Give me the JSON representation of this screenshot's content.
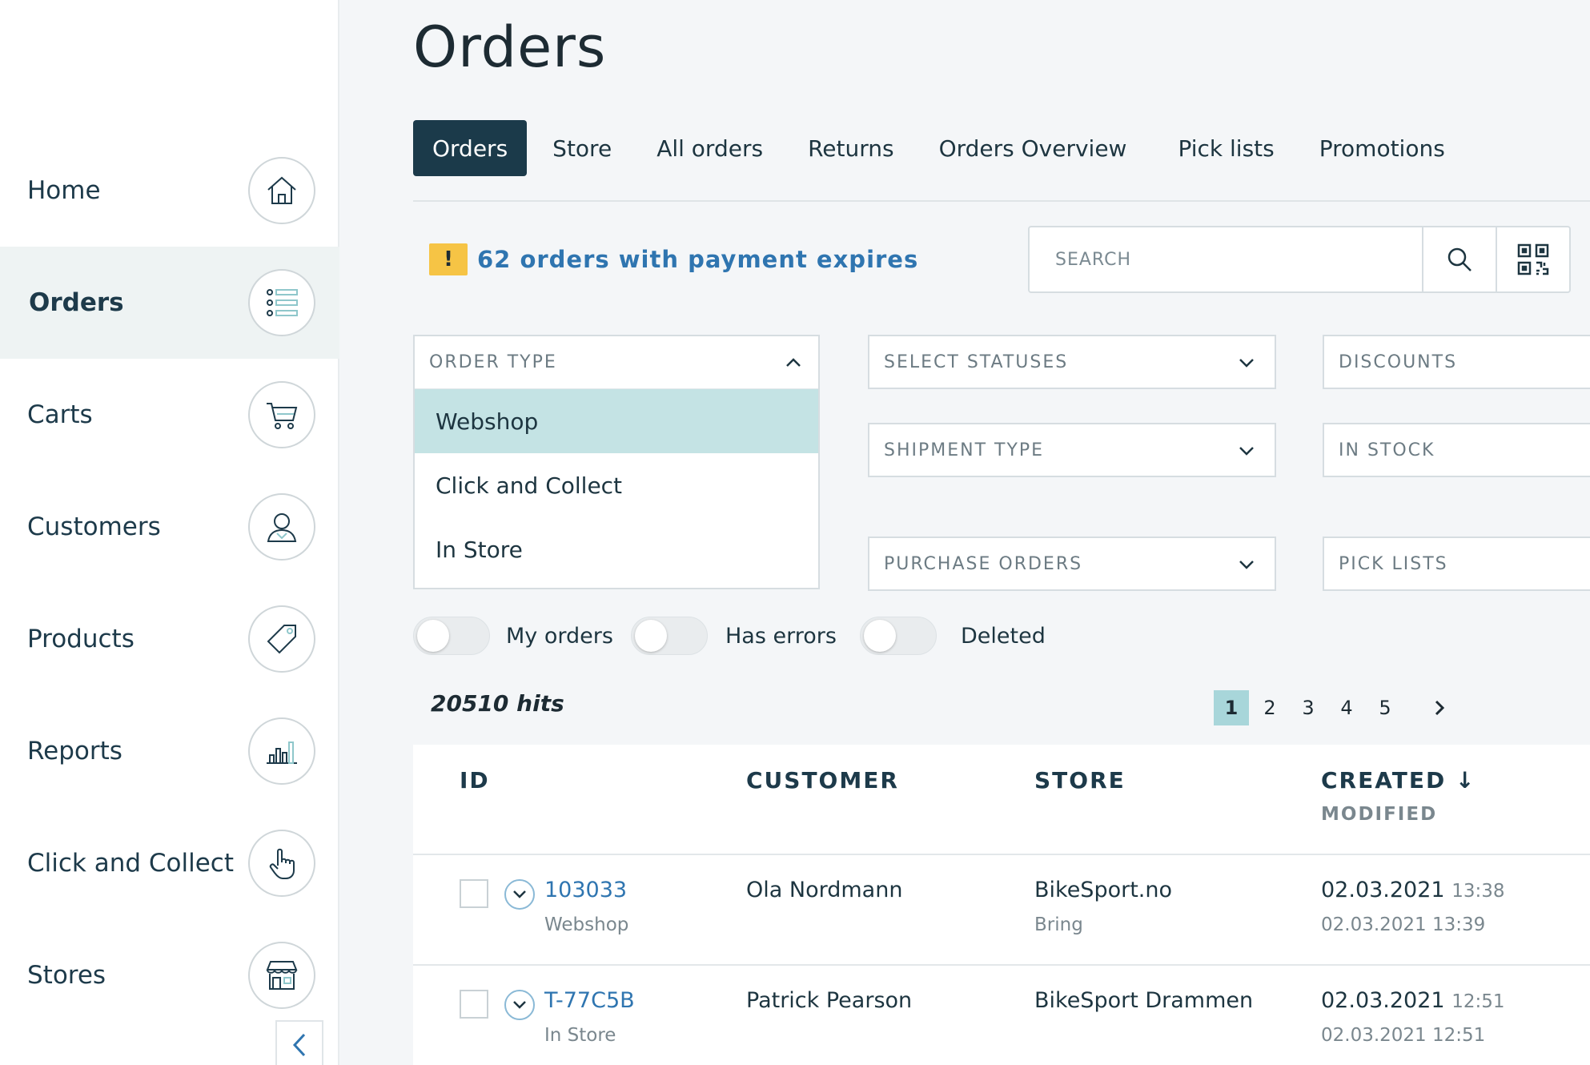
{
  "sidebar": {
    "items": [
      {
        "label": "Home",
        "icon": "home-icon"
      },
      {
        "label": "Orders",
        "icon": "list-icon",
        "active": true
      },
      {
        "label": "Carts",
        "icon": "cart-icon"
      },
      {
        "label": "Customers",
        "icon": "user-icon"
      },
      {
        "label": "Products",
        "icon": "tag-icon"
      },
      {
        "label": "Reports",
        "icon": "bar-chart-icon"
      },
      {
        "label": "Click and Collect",
        "icon": "hand-pointer-icon"
      },
      {
        "label": "Stores",
        "icon": "store-icon"
      }
    ]
  },
  "page": {
    "title": "Orders"
  },
  "tabs": [
    {
      "label": "Orders",
      "active": true
    },
    {
      "label": "Store"
    },
    {
      "label": "All orders"
    },
    {
      "label": "Returns"
    },
    {
      "label": "Orders Overview"
    },
    {
      "label": "Pick lists"
    },
    {
      "label": "Promotions"
    }
  ],
  "warning": {
    "badge": "!",
    "text": "62 orders with payment expires"
  },
  "search": {
    "placeholder": "SEARCH"
  },
  "filters": {
    "order_type": {
      "label": "ORDER TYPE",
      "options": [
        "Webshop",
        "Click and Collect",
        "In Store"
      ],
      "highlighted": "Webshop"
    },
    "select_statuses": "SELECT STATUSES",
    "shipment_type": "SHIPMENT TYPE",
    "purchase_orders": "PURCHASE ORDERS",
    "discounts": "DISCOUNTS",
    "in_stock": "IN STOCK",
    "pick_lists": "PICK LISTS"
  },
  "toggles": [
    {
      "label": "My orders",
      "on": false
    },
    {
      "label": "Has errors",
      "on": false
    },
    {
      "label": "Deleted",
      "on": false
    }
  ],
  "results": {
    "hits": "20510 hits"
  },
  "pagination": {
    "pages": [
      "1",
      "2",
      "3",
      "4",
      "5"
    ],
    "current": "1",
    "next": "›"
  },
  "table": {
    "headers": {
      "id": "ID",
      "customer": "CUSTOMER",
      "store": "STORE",
      "created": "CREATED ↓",
      "modified": "MODIFIED"
    },
    "rows": [
      {
        "id": "103033",
        "type": "Webshop",
        "customer": "Ola Nordmann",
        "store": "BikeSport.no",
        "shipping": "Bring",
        "created_date": "02.03.2021",
        "created_time": "13:38",
        "modified": "02.03.2021 13:39"
      },
      {
        "id": "T-77C5B",
        "type": "In Store",
        "customer": "Patrick Pearson",
        "store": "BikeSport Drammen",
        "shipping": "",
        "created_date": "02.03.2021",
        "created_time": "12:51",
        "modified": "02.03.2021 12:51"
      }
    ]
  },
  "colors": {
    "accent_dark": "#1b3a4a",
    "link": "#2f75b0",
    "warning": "#f6c445",
    "highlight": "#c4e3e4"
  }
}
